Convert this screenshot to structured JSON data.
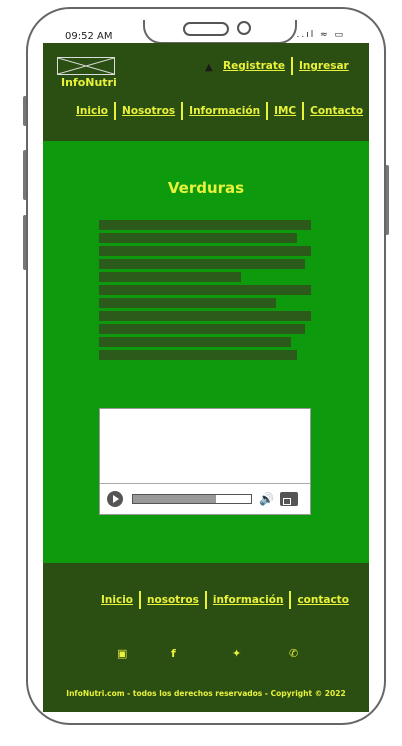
{
  "status": {
    "time": "09:52 AM",
    "icons": "..ıl ≈ ▭"
  },
  "header": {
    "brand": "InfoNutri",
    "register": "Registrate",
    "login": "Ingresar",
    "nav": [
      "Inicio",
      "Nosotros",
      "Información",
      "IMC",
      "Contacto"
    ]
  },
  "main": {
    "title": "Verduras",
    "video": {
      "progress": 0.7
    }
  },
  "footer": {
    "nav": [
      "Inicio",
      "nosotros",
      "información",
      "contacto"
    ],
    "social": [
      "instagram-icon",
      "facebook-icon",
      "twitter-icon",
      "phone-icon"
    ],
    "copyright": "InfoNutri.com - todos los derechos reservados - Copyright © 2022"
  },
  "colors": {
    "header": "#2b4e13",
    "main": "#0d9a0d",
    "accent": "#e8f23a"
  }
}
